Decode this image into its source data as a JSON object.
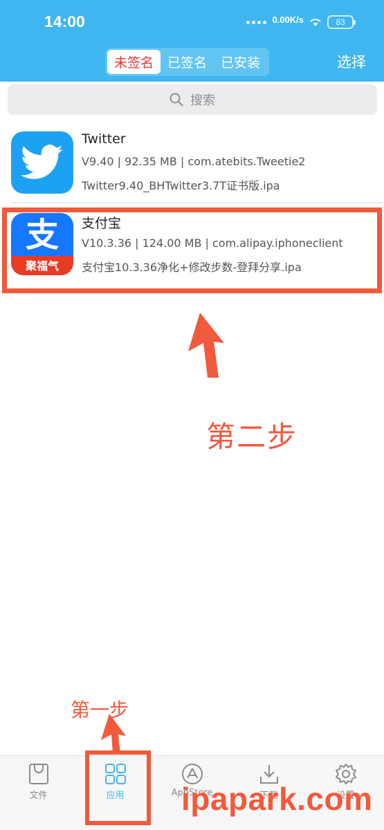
{
  "status": {
    "time": "14:00",
    "net_speed": "0.00K/s",
    "battery": "83"
  },
  "header": {
    "tabs": [
      {
        "label": "未签名",
        "active": true
      },
      {
        "label": "已签名",
        "active": false
      },
      {
        "label": "已安装",
        "active": false
      }
    ],
    "select_label": "选择",
    "accent_color": "#3fb6ef"
  },
  "search": {
    "placeholder": "搜索",
    "icon": "search-icon"
  },
  "apps": [
    {
      "name": "Twitter",
      "meta": "V9.40 | 92.35 MB | com.atebits.Tweetie2",
      "file": "Twitter9.40_BHTwitter3.7T证书版.ipa",
      "icon": "twitter-bird-icon"
    },
    {
      "name": "支付宝",
      "meta": "V10.3.36 | 124.00 MB | com.alipay.iphoneclient",
      "file": "支付宝10.3.36净化+修改步数-登拜分享.ipa",
      "icon": "alipay-icon",
      "icon_glyph": "支",
      "icon_band_text": "聚福气"
    }
  ],
  "annotations": {
    "step2": "第二步",
    "step1": "第一步",
    "highlight_color": "#f05a3a"
  },
  "tabbar": [
    {
      "label": "文件",
      "icon": "file-icon",
      "active": false
    },
    {
      "label": "应用",
      "icon": "apps-grid-icon",
      "active": true
    },
    {
      "label": "AppStore",
      "icon": "appstore-icon",
      "active": false
    },
    {
      "label": "下载",
      "icon": "download-icon",
      "active": false
    },
    {
      "label": "设置",
      "icon": "gear-icon",
      "active": false
    }
  ],
  "watermark": "ipapark.com"
}
